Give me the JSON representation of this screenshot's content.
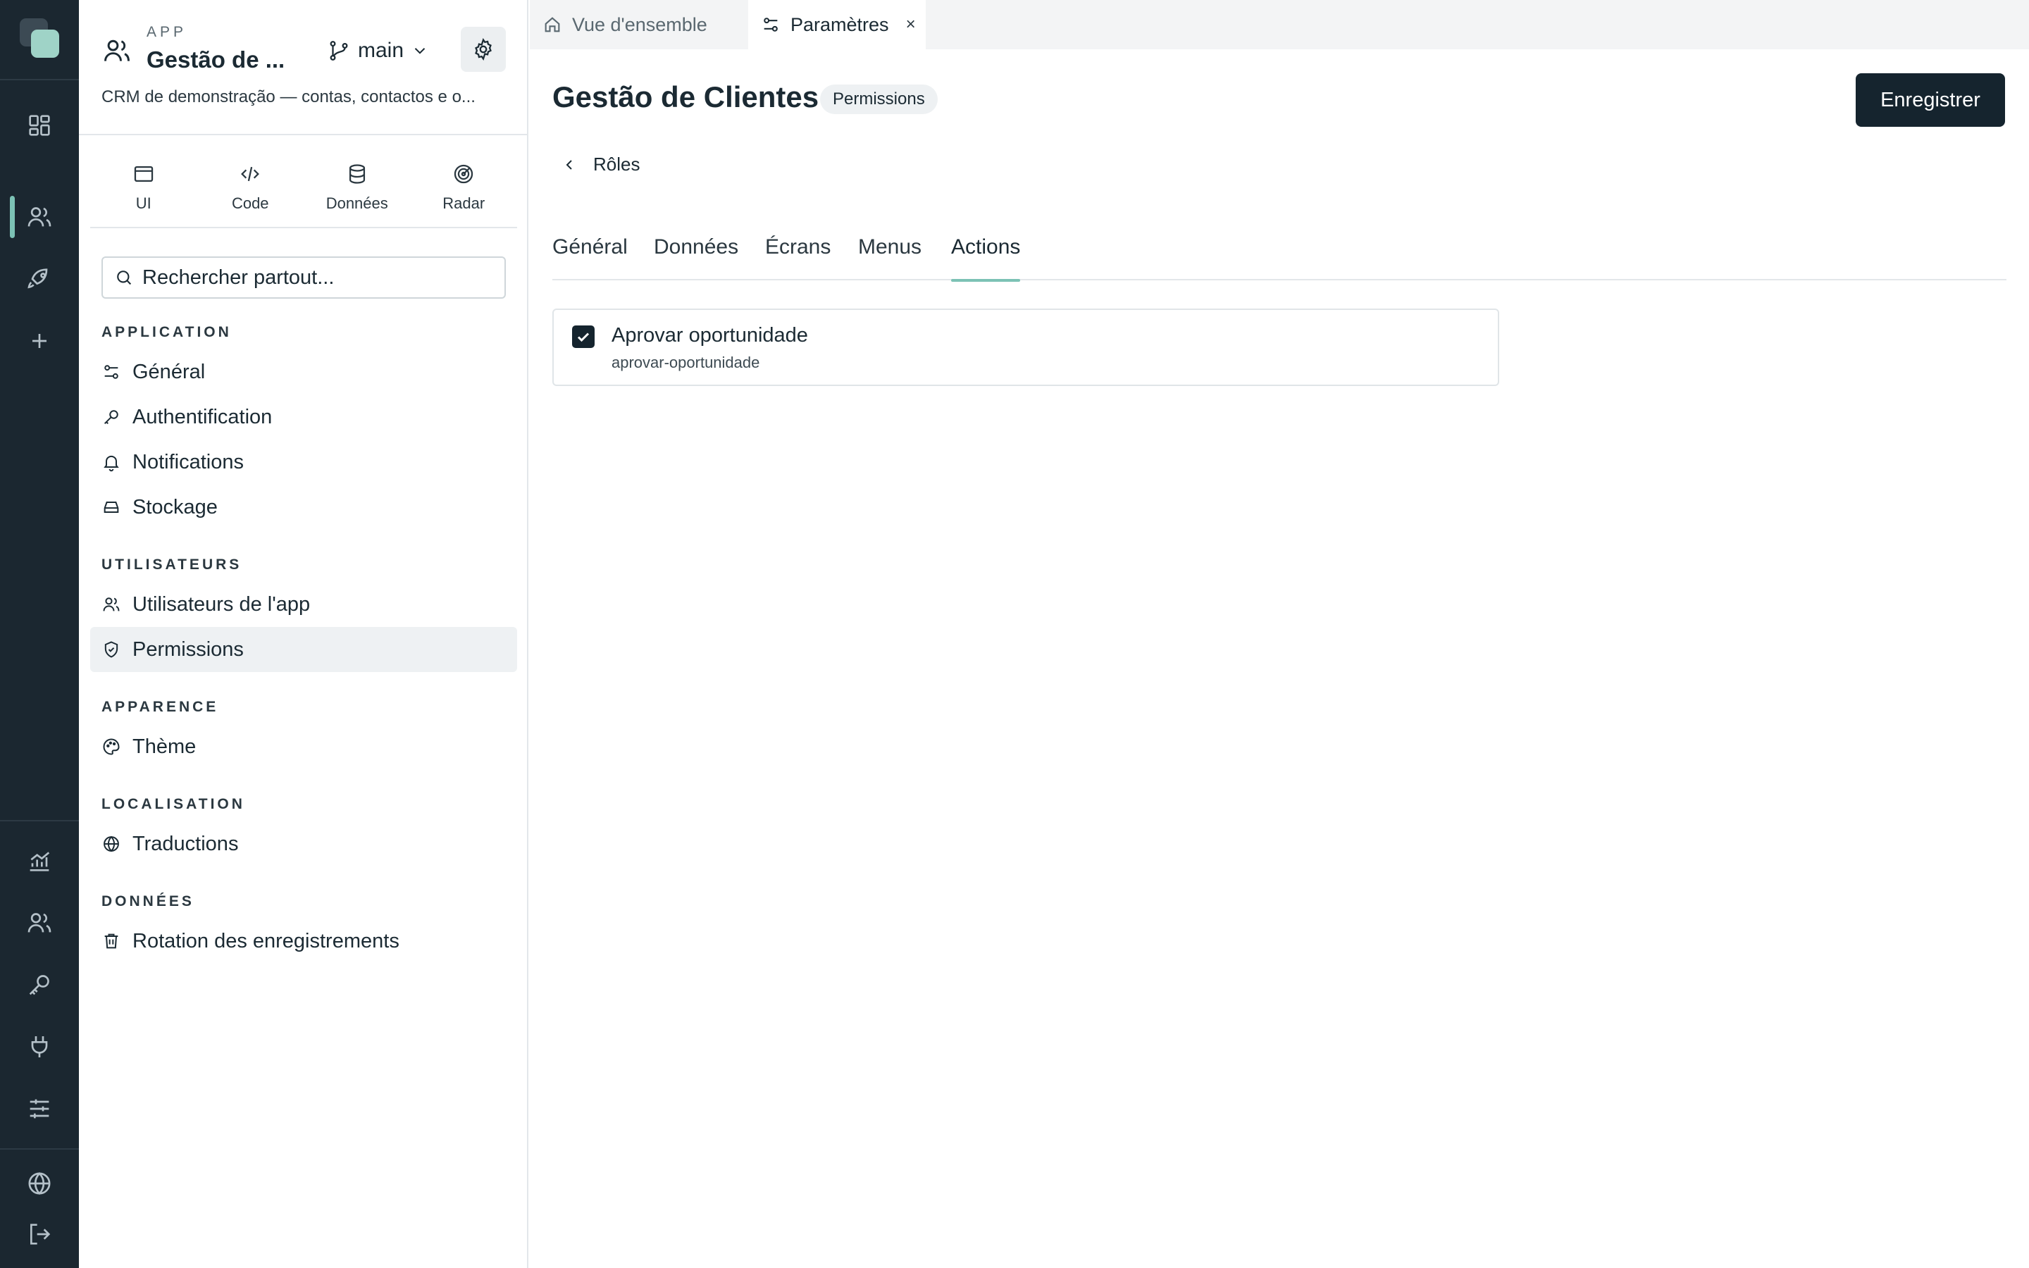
{
  "rail": {
    "top_icons": [
      "dashboard-icon",
      "users-icon",
      "rocket-icon",
      "plus-icon"
    ],
    "bottom_icons": [
      "chart-icon",
      "team-icon",
      "key-icon",
      "plug-icon",
      "sliders-icon",
      "globe-icon",
      "logout-icon"
    ],
    "active_item": "users-icon",
    "accent_color": "#7cc2b5",
    "background": "#1b2730"
  },
  "app": {
    "kicker": "APP",
    "name": "Gestão de ...",
    "branch": "main",
    "description": "CRM de demonstração — contas, contactos e o..."
  },
  "modes": [
    {
      "label": "UI",
      "icon": "window-icon"
    },
    {
      "label": "Code",
      "icon": "code-icon"
    },
    {
      "label": "Données",
      "icon": "database-icon"
    },
    {
      "label": "Radar",
      "icon": "radar-icon"
    }
  ],
  "search": {
    "placeholder": "Rechercher partout..."
  },
  "nav": {
    "sections": [
      {
        "label": "APPLICATION",
        "items": [
          {
            "label": "Général",
            "icon": "sliders-icon"
          },
          {
            "label": "Authentification",
            "icon": "key-icon"
          },
          {
            "label": "Notifications",
            "icon": "bell-icon"
          },
          {
            "label": "Stockage",
            "icon": "storage-icon"
          }
        ]
      },
      {
        "label": "UTILISATEURS",
        "items": [
          {
            "label": "Utilisateurs de l'app",
            "icon": "users-icon"
          },
          {
            "label": "Permissions",
            "icon": "shield-icon",
            "selected": true
          }
        ]
      },
      {
        "label": "APPARENCE",
        "items": [
          {
            "label": "Thème",
            "icon": "palette-icon"
          }
        ]
      },
      {
        "label": "LOCALISATION",
        "items": [
          {
            "label": "Traductions",
            "icon": "globe-icon"
          }
        ]
      },
      {
        "label": "DONNÉES",
        "items": [
          {
            "label": "Rotation des enregistrements",
            "icon": "trash-icon"
          }
        ]
      }
    ]
  },
  "tabs": [
    {
      "label": "Vue d'ensemble",
      "icon": "home-icon",
      "active": false
    },
    {
      "label": "Paramètres",
      "icon": "sliders-icon",
      "active": true,
      "close": "×"
    }
  ],
  "page": {
    "title": "Gestão de Clientes",
    "badge": "Permissions",
    "save_label": "Enregistrer",
    "back_label": "Rôles",
    "subtabs": [
      "Général",
      "Données",
      "Écrans",
      "Menus",
      "Actions"
    ],
    "active_subtab": "Actions"
  },
  "actions": [
    {
      "name": "Aprovar oportunidade",
      "slug": "aprovar-oportunidade",
      "checked": true
    }
  ]
}
